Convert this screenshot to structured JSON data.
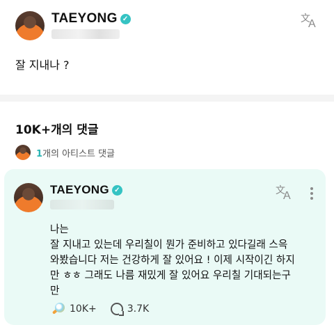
{
  "post": {
    "author": "TAEYONG",
    "text": "잘 지내나 ?"
  },
  "comments": {
    "count_label": "10K+개의 댓글",
    "artist_comment_count": "1",
    "artist_comment_label": "개의 아티스트 댓글"
  },
  "comment": {
    "author": "TAEYONG",
    "lines": [
      "나는",
      "잘 지내고 있는데 우리칠이 뭔가 준비하고 있다길래 스윽",
      "와봤습니다 저는 건강하게 잘 있어요 ! 이제 시작이긴 하지",
      "만 ㅎㅎ 그래도 나름 재밌게 잘 있어요 우리칠 기대되는구",
      "만"
    ],
    "likes": "10K+",
    "replies": "3.7K"
  },
  "icons": {
    "verified": "verified-check-icon",
    "translate": "translate-icon",
    "more": "more-vertical-icon",
    "lightstick": "lightstick-icon",
    "reply": "reply-bubble-icon"
  },
  "colors": {
    "accent": "#35c3c3",
    "comment_card_bg": "#eafaf6"
  }
}
